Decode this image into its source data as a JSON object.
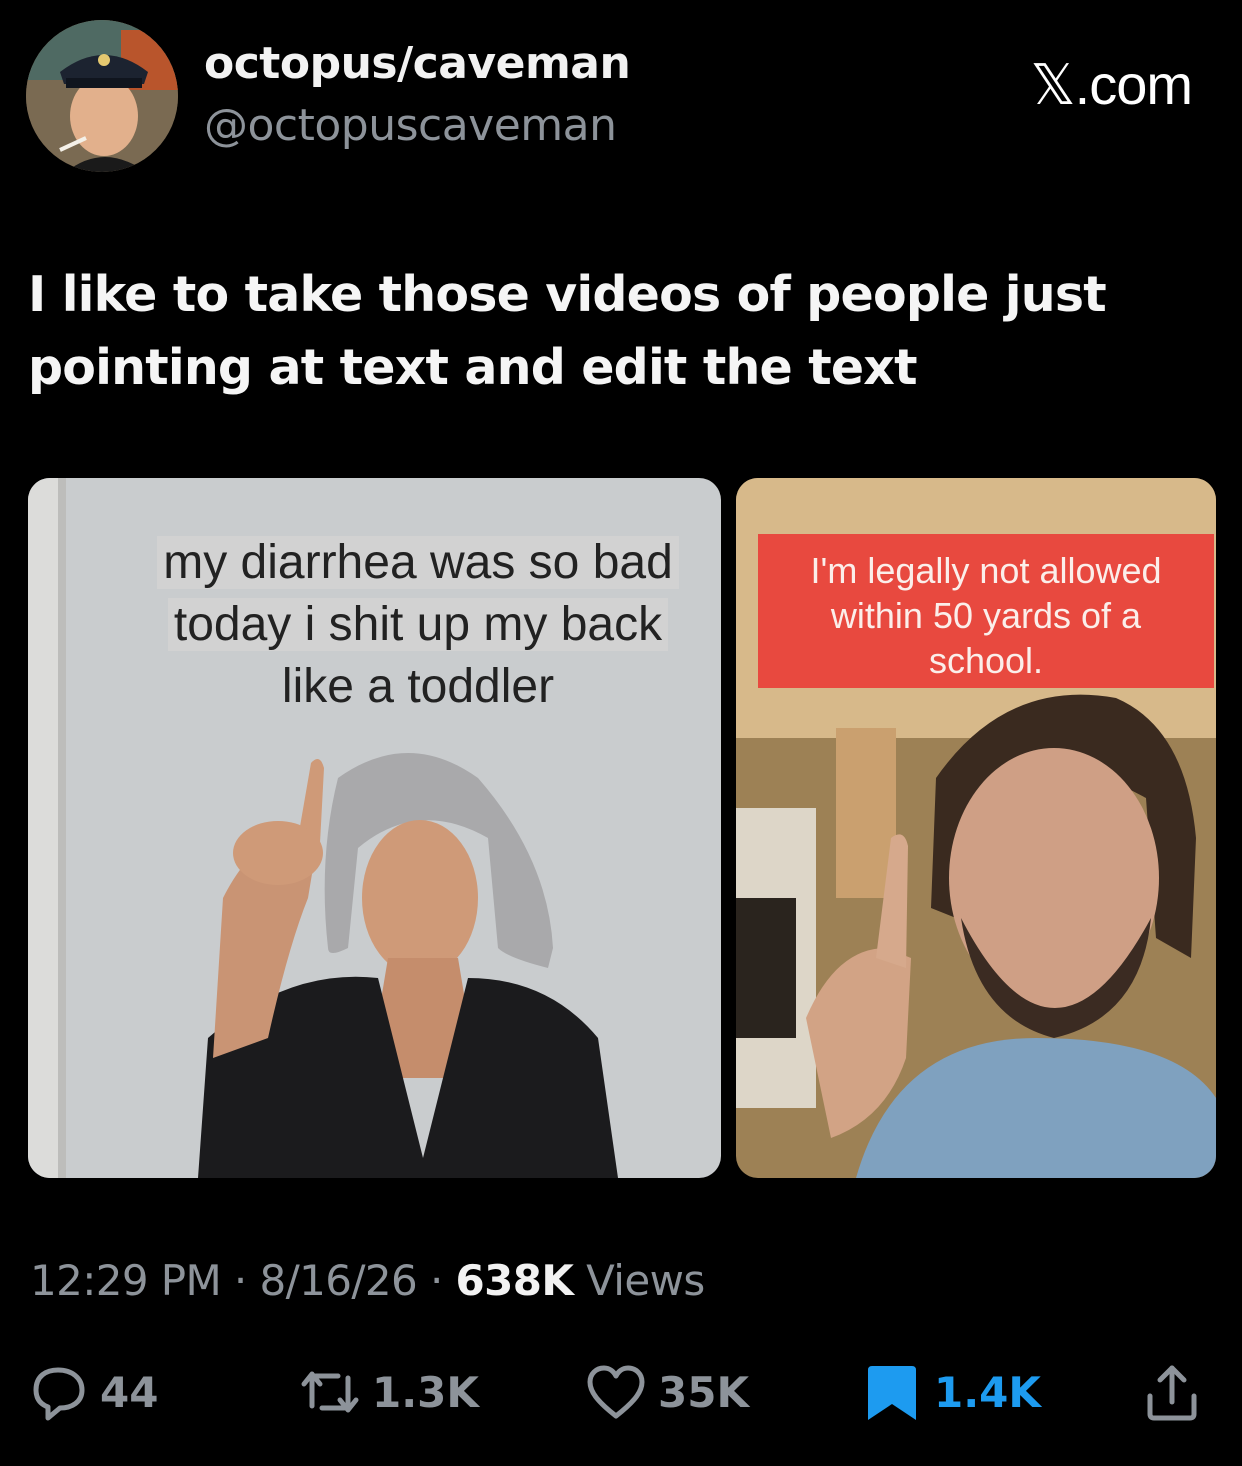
{
  "author": {
    "display_name": "octopus/caveman",
    "handle": "@octopuscaveman"
  },
  "brand": "𝕏.com",
  "tweet": {
    "text_line1": "I like to take those videos of people just",
    "text_line2": "pointing at text and edit the text"
  },
  "media": [
    {
      "caption_lines": [
        "my diarrhea was so bad",
        "today i shit up my back",
        "like a toddler"
      ]
    },
    {
      "caption_lines": [
        "I'm legally not allowed",
        "within 50 yards of a",
        "school."
      ]
    }
  ],
  "meta": {
    "time": "12:29 PM",
    "date": "8/16/26",
    "views_count": "638K",
    "views_label": "Views",
    "separator": "·"
  },
  "actions": {
    "replies": "44",
    "reposts": "1.3K",
    "likes": "35K",
    "bookmarks": "1.4K"
  },
  "colors": {
    "background": "#000000",
    "bookmark_active": "#1d9bf0",
    "muted": "#8d939a",
    "caption_red": "#e8493f"
  }
}
